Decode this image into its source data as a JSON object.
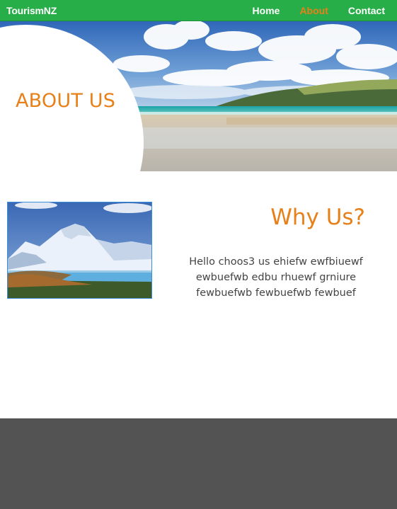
{
  "navbar": {
    "brand": "TourismNZ",
    "links": [
      {
        "label": "Home",
        "active": false
      },
      {
        "label": "About",
        "active": true
      },
      {
        "label": "Contact",
        "active": false
      }
    ]
  },
  "hero": {
    "title": "ABOUT US"
  },
  "why_us": {
    "title": "Why Us?",
    "body": "Hello choos3 us ehiefw ewfbiuewf ewbuefwb edbu rhuewf grniure fewbuefwb fewbuefwb fewbuef"
  },
  "colors": {
    "nav_bg": "#27ae48",
    "accent": "#e8801a",
    "footer_bg": "#535353",
    "text": "#444444"
  }
}
